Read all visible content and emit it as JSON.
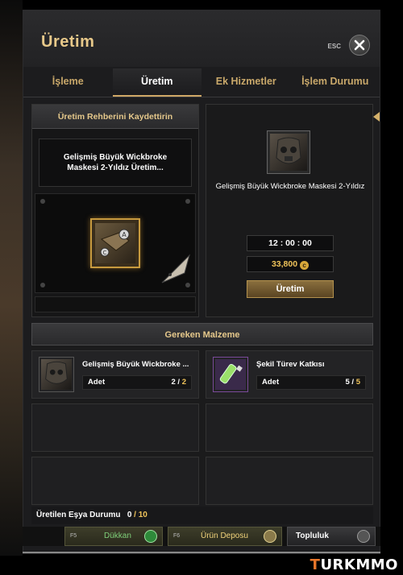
{
  "window": {
    "title": "Üretim",
    "esc_label": "ESC"
  },
  "tabs": [
    {
      "label": "İşleme"
    },
    {
      "label": "Üretim",
      "active": true
    },
    {
      "label": "Ek Hizmetler"
    },
    {
      "label": "İşlem Durumu"
    }
  ],
  "left_panel": {
    "register_label": "Üretim Rehberini Kaydettirin",
    "recipe_name": "Gelişmiş Büyük Wickbroke Maskesi 2-Yıldız Üretim..."
  },
  "right_panel": {
    "item_name": "Gelişmiş Büyük Wickbroke Maskesi 2-Yıldız",
    "time": "12 : 00 : 00",
    "cost": "33,800",
    "produce_label": "Üretim"
  },
  "materials": {
    "header": "Gereken Malzeme",
    "items": [
      {
        "name": "Gelişmiş Büyük Wickbroke ...",
        "qty_label": "Adet",
        "have": "2",
        "need": "2"
      },
      {
        "name": "Şekil Türev Katkısı",
        "qty_label": "Adet",
        "have": "5",
        "need": "5"
      }
    ]
  },
  "status": {
    "label": "Üretilen Eşya Durumu",
    "current": "0",
    "max": "10"
  },
  "bottom_bar": {
    "shop": {
      "key": "F5",
      "label": "Dükkan"
    },
    "depot": {
      "key": "F6",
      "label": "Ürün Deposu"
    },
    "community": {
      "label": "Topluluk"
    }
  },
  "watermark": {
    "prefix": "T",
    "text": "URKMMO"
  },
  "colors": {
    "accent": "#e8c98a",
    "gold": "#f0c45a",
    "frame": "#1c1c1e"
  }
}
